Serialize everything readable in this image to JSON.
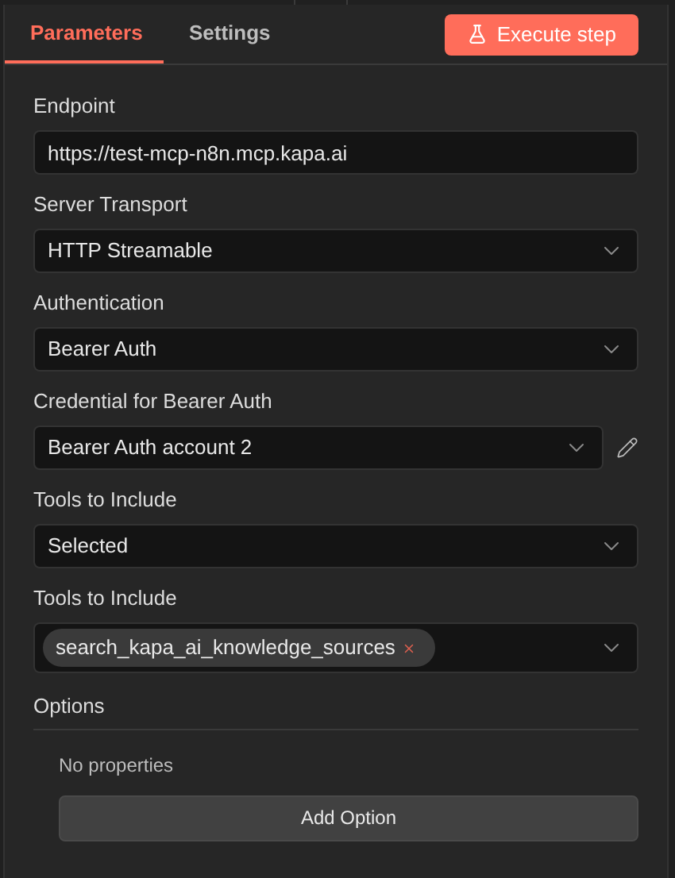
{
  "tabs": [
    {
      "label": "Parameters",
      "selected": true
    },
    {
      "label": "Settings",
      "selected": false
    }
  ],
  "execute_button": {
    "label": "Execute step"
  },
  "fields": [
    {
      "kind": "text",
      "label": "Endpoint",
      "value": "https://test-mcp-n8n.mcp.kapa.ai"
    },
    {
      "kind": "select",
      "label": "Server Transport",
      "value": "HTTP Streamable"
    },
    {
      "kind": "select",
      "label": "Authentication",
      "value": "Bearer Auth"
    },
    {
      "kind": "credential",
      "label": "Credential for Bearer Auth",
      "value": "Bearer Auth account 2"
    },
    {
      "kind": "select",
      "label": "Tools to Include",
      "value": "Selected"
    },
    {
      "kind": "multiselect",
      "label": "Tools to Include",
      "chips": [
        "search_kapa_ai_knowledge_sources"
      ]
    }
  ],
  "options": {
    "title": "Options",
    "empty_text": "No properties",
    "button": "Add Option"
  }
}
